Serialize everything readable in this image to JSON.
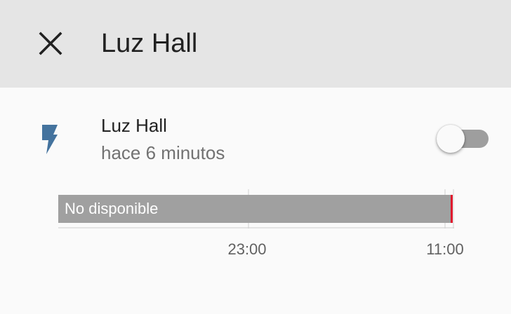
{
  "header": {
    "close_icon": "close-icon",
    "title": "Luz Hall"
  },
  "entity": {
    "icon": "flash-icon",
    "icon_color": "#44739e",
    "name": "Luz Hall",
    "last_changed": "hace 6 minutos",
    "toggle_on": false
  },
  "history": {
    "bar_label": "No disponible",
    "bar_color": "#a0a0a0",
    "marker_color": "#e01a2e",
    "axis_ticks": [
      "23:00",
      "11:00"
    ]
  }
}
